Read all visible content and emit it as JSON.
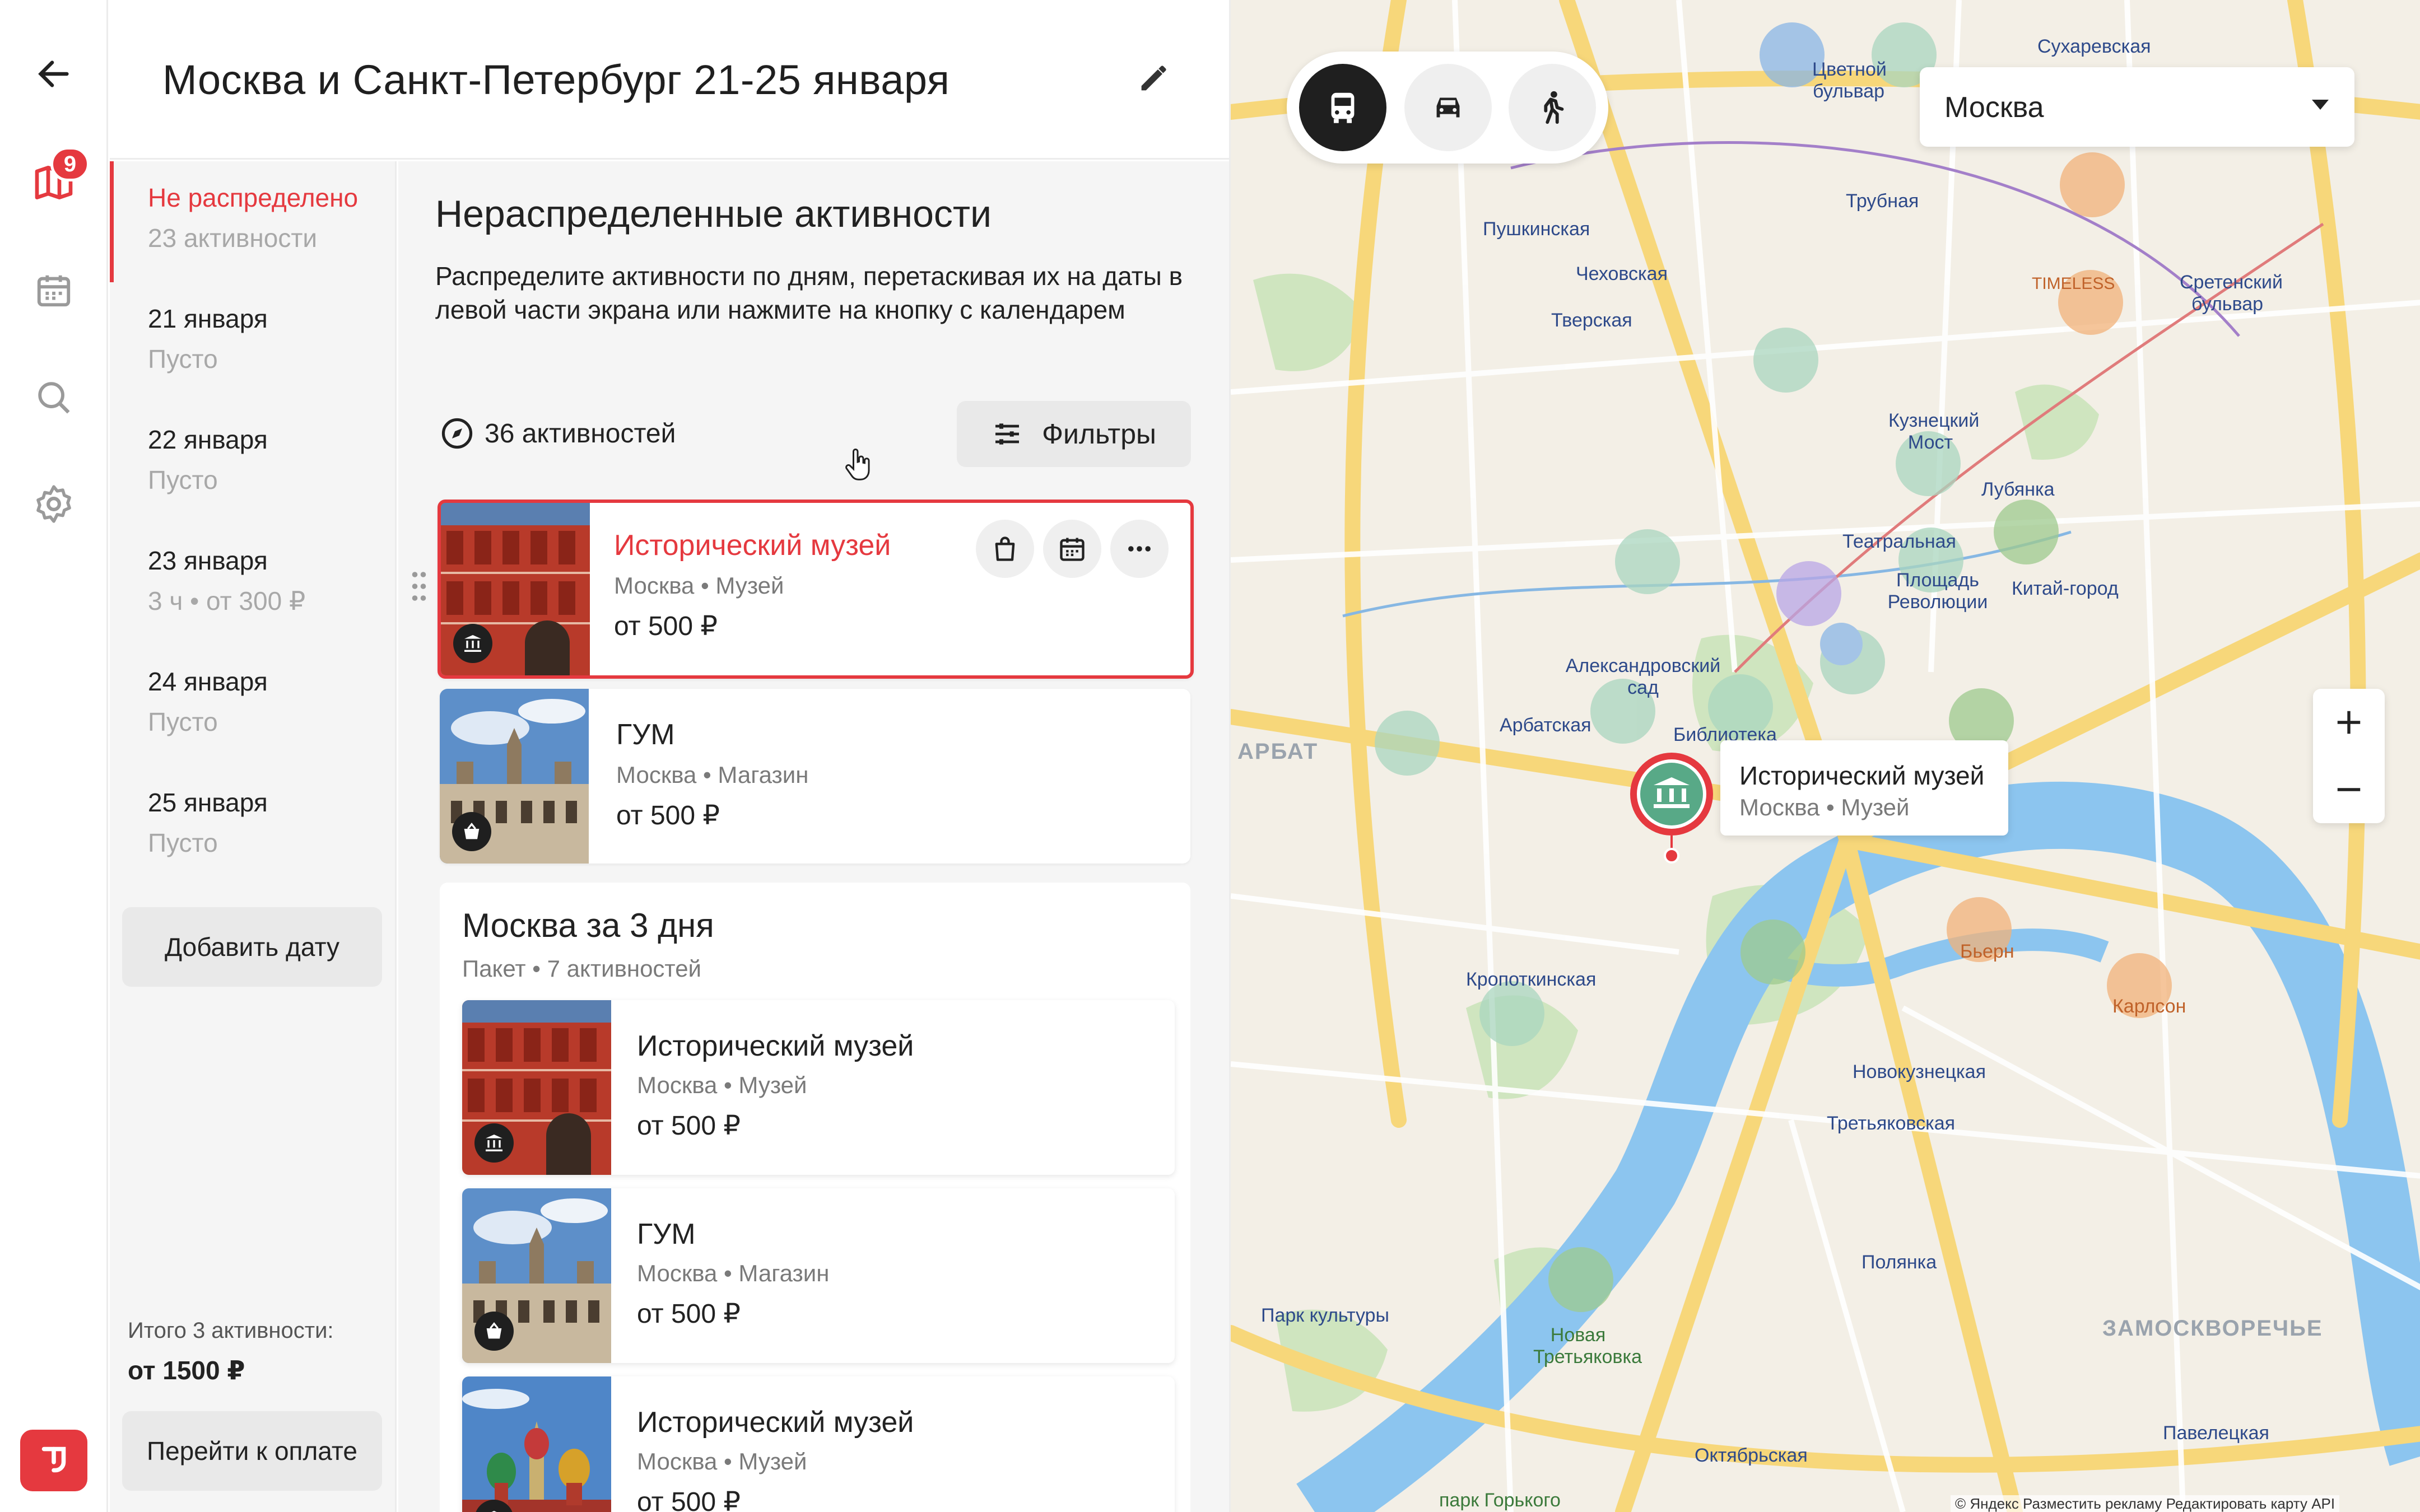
{
  "header": {
    "title": "Москва и Санкт-Петербург 21-25 января"
  },
  "rail": {
    "badge_count": "9"
  },
  "dates": {
    "items": [
      {
        "label": "Не распределено",
        "sub": "23 активности",
        "active": true
      },
      {
        "label": "21 января",
        "sub": "Пусто"
      },
      {
        "label": "22 января",
        "sub": "Пусто"
      },
      {
        "label": "23 января",
        "sub": "3 ч • от 300 ₽"
      },
      {
        "label": "24 января",
        "sub": "Пусто"
      },
      {
        "label": "25 января",
        "sub": "Пусто"
      }
    ],
    "add_date_label": "Добавить дату",
    "total_label": "Итого 3 активности:",
    "total_price": "от 1500 ₽",
    "pay_label": "Перейти к оплате"
  },
  "content": {
    "title": "Нераспределенные активности",
    "description": "Распределите активности по дням, перетаскивая их на даты в левой части экрана или нажмите на кнопку с календарем",
    "count_label": "36 активностей",
    "filters_label": "Фильтры",
    "cards": [
      {
        "title": "Исторический музей",
        "meta": "Москва • Музей",
        "price": "от 500 ₽",
        "icon": "museum-icon",
        "selected": true
      },
      {
        "title": "ГУМ",
        "meta": "Москва • Магазин",
        "price": "от 500 ₽",
        "icon": "shop-icon"
      }
    ],
    "package": {
      "title": "Москва за 3 дня",
      "meta": "Пакет • 7 активностей",
      "items": [
        {
          "title": "Исторический музей",
          "meta": "Москва • Музей",
          "price": "от 500 ₽",
          "icon": "museum-icon"
        },
        {
          "title": "ГУМ",
          "meta": "Москва • Магазин",
          "price": "от 500 ₽",
          "icon": "shop-icon"
        },
        {
          "title": "Исторический музей",
          "meta": "Москва • Музей",
          "price": "от 500 ₽",
          "icon": "museum-icon"
        }
      ]
    }
  },
  "map": {
    "city": "Москва",
    "tooltip": {
      "title": "Исторический музей",
      "meta": "Москва • Музей"
    },
    "labels": [
      "Сухаревская",
      "Цветной бульвар",
      "Трубная",
      "Пушкинская",
      "Чеховская",
      "Тверская",
      "Кузнецкий Мост",
      "Лубянка",
      "Театральная",
      "Площадь Революции",
      "Китай-город",
      "Александровский сад",
      "Арбатская",
      "Библиотека",
      "Кропоткинская",
      "Новокузнецкая",
      "Третьяковская",
      "Полянка",
      "Парк культуры",
      "Октябрьская",
      "Павелецкая",
      "Сретенский бульвар",
      "ЗАМОСКВОРЕЧЬЕ",
      "АРБАТ",
      "Карлсон",
      "Бьерн",
      "TIMELESS",
      "Новая Третьяковка",
      "парк Горького"
    ],
    "attribution": "© Яндекс   Разместить рекламу   Редактировать карту   API"
  },
  "colors": {
    "accent": "#e5393f",
    "map_water": "#8cc5ef",
    "map_road": "#f7d77a",
    "map_park": "#cfe5bf"
  }
}
